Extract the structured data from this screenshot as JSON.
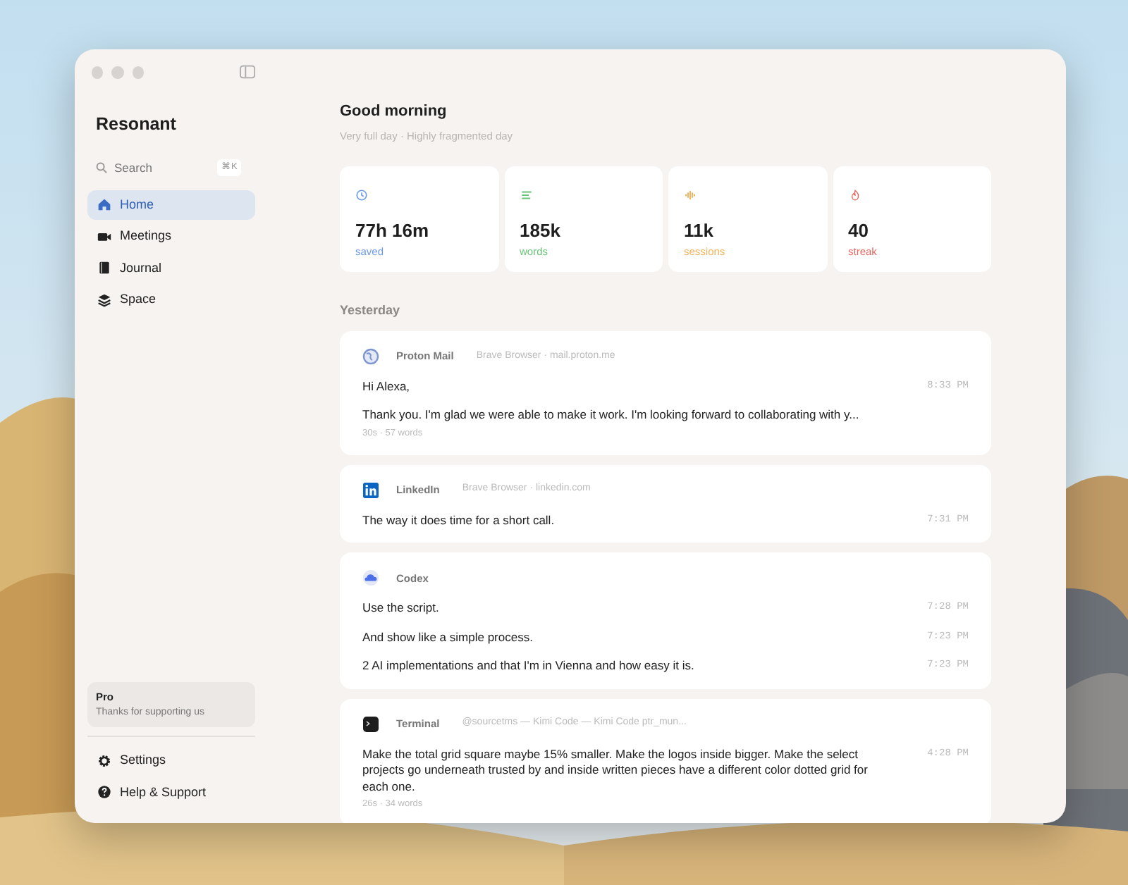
{
  "app": {
    "name": "Resonant"
  },
  "search": {
    "placeholder": "Search",
    "shortcut": "⌘K"
  },
  "nav": [
    {
      "label": "Home",
      "selected": true
    },
    {
      "label": "Meetings",
      "selected": false
    },
    {
      "label": "Journal",
      "selected": false
    },
    {
      "label": "Space",
      "selected": false
    }
  ],
  "plan": {
    "title": "Pro",
    "subtitle": "Thanks for supporting us"
  },
  "footer_nav": [
    {
      "label": "Settings"
    },
    {
      "label": "Help & Support"
    }
  ],
  "greeting": {
    "title": "Good morning",
    "subtitle": "Very full day · Highly fragmented day"
  },
  "stats": [
    {
      "value": "77h 16m",
      "label": "saved",
      "color": "#6b9bea"
    },
    {
      "value": "185k",
      "label": "words",
      "color": "#6cc47a"
    },
    {
      "value": "11k",
      "label": "sessions",
      "color": "#f2b25c"
    },
    {
      "value": "40",
      "label": "streak",
      "color": "#e66a63"
    }
  ],
  "section": "Yesterday",
  "entries": [
    {
      "app": "Proton Mail",
      "source": "Brave Browser · mail.proton.me",
      "lines": [
        {
          "text": "Hi Alexa,",
          "time": "8:33 PM"
        },
        {
          "text": "Thank you. I'm glad we were able to make it work. I'm looking forward to collaborating with y..."
        }
      ],
      "meta": "30s · 57 words"
    },
    {
      "app": "LinkedIn",
      "source": "Brave Browser · linkedin.com",
      "lines": [
        {
          "text": "The way it does time for a short call.",
          "time": "7:31 PM"
        }
      ]
    },
    {
      "app": "Codex",
      "lines": [
        {
          "text": "Use the script.",
          "time": "7:28 PM"
        },
        {
          "text": "And show like a simple process.",
          "time": "7:23 PM"
        },
        {
          "text": "2 AI implementations and that I'm in Vienna and how easy it is.",
          "time": "7:23 PM"
        }
      ]
    },
    {
      "app": "Terminal",
      "source": "@sourcetms — Kimi Code — Kimi Code ptr_mun...",
      "lines": [
        {
          "text": "Make the total grid square maybe 15% smaller. Make the logos inside bigger. Make the select projects go underneath trusted by and inside written pieces have a different color dotted grid for each one.",
          "time": "4:28 PM"
        }
      ],
      "meta": "26s · 34 words"
    }
  ]
}
